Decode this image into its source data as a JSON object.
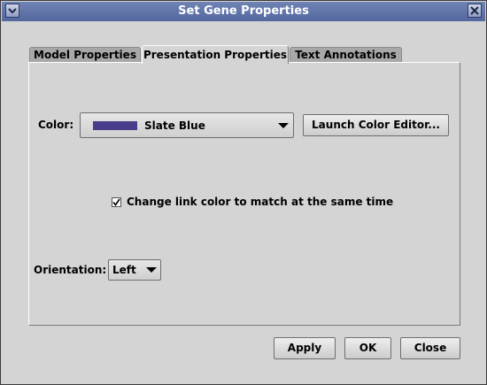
{
  "window": {
    "title": "Set Gene Properties"
  },
  "tabs": [
    {
      "label": "Model Properties",
      "active": false
    },
    {
      "label": "Presentation Properties",
      "active": true
    },
    {
      "label": "Text Annotations",
      "active": false
    }
  ],
  "presentation": {
    "color_label": "Color:",
    "color_value": "Slate Blue",
    "color_swatch_hex": "#483d8b",
    "launch_color_editor_label": "Launch Color Editor...",
    "link_color_checkbox_label": "Change link color to match at the same time",
    "link_color_checked": true,
    "orientation_label": "Orientation:",
    "orientation_value": "Left"
  },
  "footer": {
    "apply_label": "Apply",
    "ok_label": "OK",
    "close_label": "Close"
  },
  "icons": {
    "window_menu": "chevron-down-icon",
    "window_close": "close-icon",
    "dropdown": "triangle-down-icon",
    "checkmark": "checkmark-icon"
  },
  "colors": {
    "titlebar": "#5f73aa",
    "background": "#d4d4d4",
    "swatch": "#483d8b"
  }
}
